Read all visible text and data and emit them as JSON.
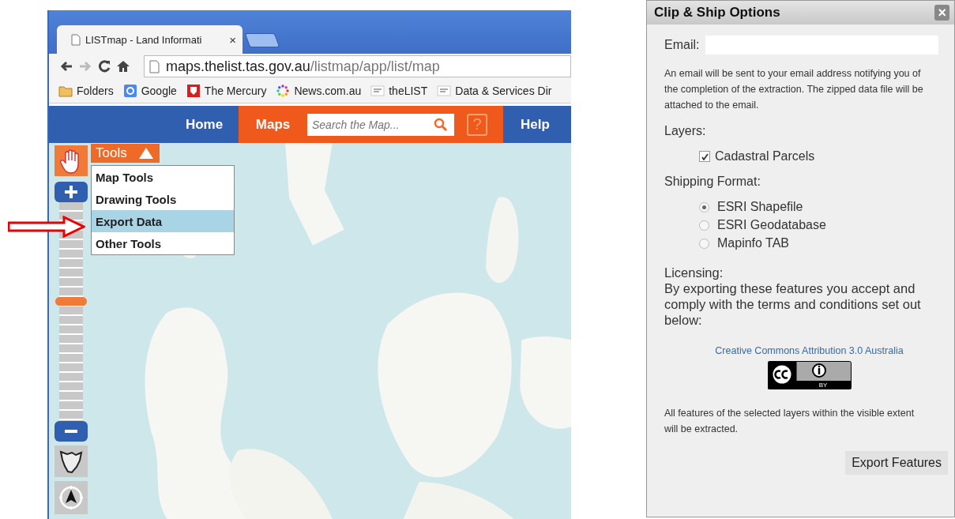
{
  "browser": {
    "tab": {
      "title": "LISTmap - Land Informati",
      "close": "×"
    },
    "address": {
      "host": "maps.thelist.tas.gov.au",
      "path": "/listmap/app/list/map"
    },
    "bookmarks": [
      {
        "label": "Folders",
        "kind": "folder"
      },
      {
        "label": "Google",
        "kind": "google"
      },
      {
        "label": "The Mercury",
        "kind": "mercury"
      },
      {
        "label": "News.com.au",
        "kind": "news"
      },
      {
        "label": "theLIST",
        "kind": "list"
      },
      {
        "label": "Data & Services Dir",
        "kind": "list"
      }
    ]
  },
  "site_nav": {
    "items": [
      {
        "label": "Home",
        "selected": false
      },
      {
        "label": "Maps",
        "selected": true
      }
    ],
    "search": {
      "placeholder": "Search the Map..."
    },
    "help_glyph": "?",
    "help_link": "Help"
  },
  "map": {
    "tools_menu": {
      "label": "Tools",
      "expanded": true,
      "items": [
        {
          "label": "Map Tools",
          "selected": false
        },
        {
          "label": "Drawing Tools",
          "selected": false
        },
        {
          "label": "Export Data",
          "selected": true
        },
        {
          "label": "Other Tools",
          "selected": false
        }
      ]
    },
    "zoom": {
      "level": 0.55
    }
  },
  "dialog": {
    "title": "Clip & Ship Options",
    "close": "×",
    "email_label": "Email:",
    "email_note": "An email will be sent to your email address notifying you of the completion of the extraction. The zipped data file will be attached to the email.",
    "layers_label": "Layers:",
    "layers": [
      {
        "label": "Cadastral Parcels",
        "checked": true
      }
    ],
    "format_label": "Shipping Format:",
    "formats": [
      {
        "label": "ESRI Shapefile",
        "selected": true
      },
      {
        "label": "ESRI Geodatabase",
        "selected": false
      },
      {
        "label": "Mapinfo TAB",
        "selected": false
      }
    ],
    "licensing_label": "Licensing:",
    "licensing_text": "By exporting these features you accept and comply with the terms and conditions set out below:",
    "license_link": "Creative Commons Attribution 3.0 Australia",
    "badge_text": "BY",
    "extent_note": "All features of the selected layers within the visible extent will be extracted.",
    "export_button": "Export Features"
  }
}
